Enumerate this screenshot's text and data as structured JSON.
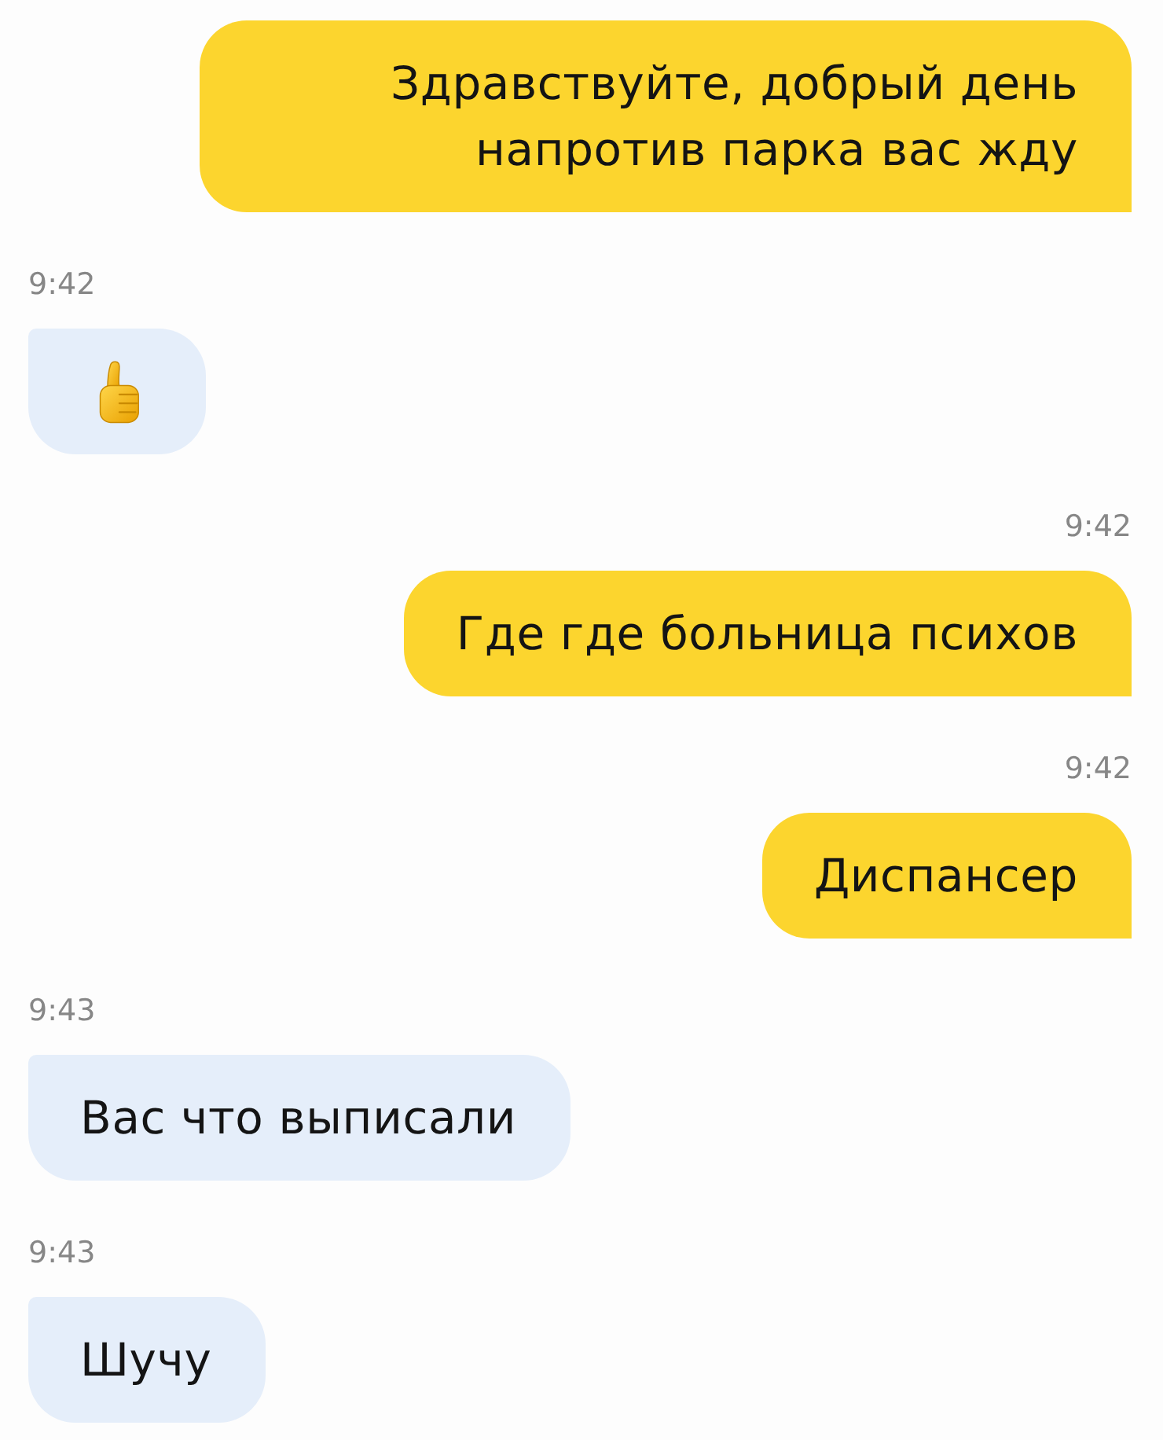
{
  "messages": [
    {
      "kind": "text",
      "outgoing": true,
      "text": "Здравствуйте, добрый день напротив парка вас жду"
    },
    {
      "kind": "emoji",
      "outgoing": false,
      "time": "9:42"
    },
    {
      "kind": "text",
      "outgoing": true,
      "time": "9:42",
      "text": "Где где больница психов"
    },
    {
      "kind": "text",
      "outgoing": true,
      "time": "9:42",
      "text": "Диспансер"
    },
    {
      "kind": "text",
      "outgoing": false,
      "time": "9:43",
      "text": "Вас что выписали"
    },
    {
      "kind": "text",
      "outgoing": false,
      "time": "9:43",
      "text": "Шучу"
    }
  ]
}
